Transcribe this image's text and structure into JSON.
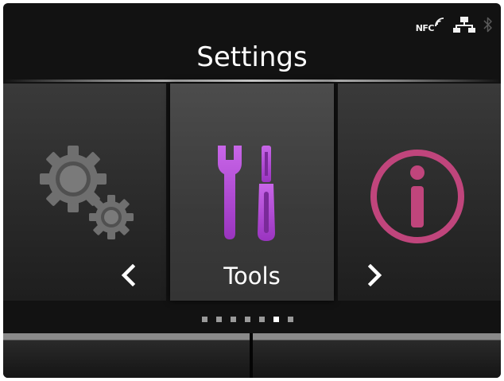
{
  "status": {
    "nfc_label": "NFC",
    "icons": [
      "nfc-icon",
      "network-icon",
      "bluetooth-icon"
    ]
  },
  "header": {
    "title": "Settings"
  },
  "carousel": {
    "items": [
      {
        "icon": "gear-icon",
        "label": ""
      },
      {
        "icon": "tools-icon",
        "label": "Tools"
      },
      {
        "icon": "info-icon",
        "label": ""
      }
    ],
    "selected_index": 1,
    "prev_icon": "chevron-left-icon",
    "next_icon": "chevron-right-icon"
  },
  "pagination": {
    "total": 7,
    "active_index": 5
  },
  "softkeys": {
    "left_label": "",
    "right_label": ""
  },
  "colors": {
    "background": "#121212",
    "accent_tools": "#b24fd6",
    "accent_info": "#c0457c",
    "gear": "#6f6f6f"
  }
}
